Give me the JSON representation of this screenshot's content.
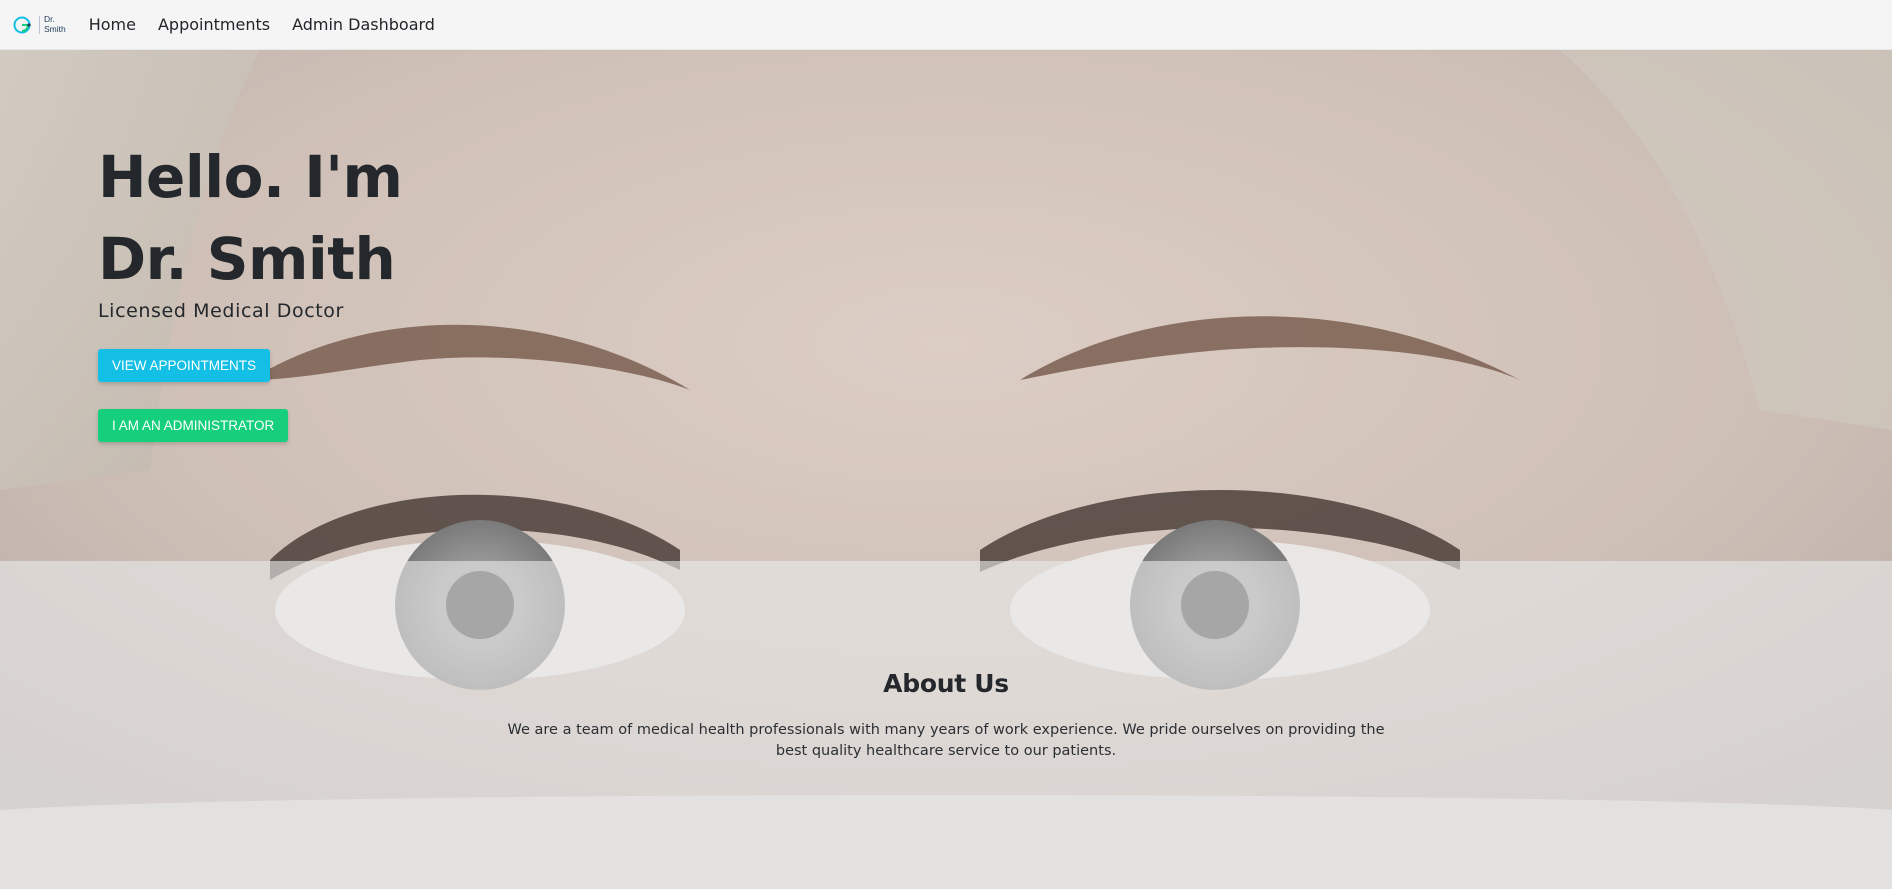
{
  "navbar": {
    "brand_line1": "Dr.",
    "brand_line2": "Smith",
    "links": [
      "Home",
      "Appointments",
      "Admin Dashboard"
    ]
  },
  "hero": {
    "title_line1": "Hello. I'm",
    "title_line2": "Dr. Smith",
    "subtitle": "Licensed Medical Doctor",
    "btn_appointments": "View Appointments",
    "btn_admin": "I am an Administrator"
  },
  "about": {
    "title": "About Us",
    "text": "We are a team of medical health professionals with many years of work experience. We pride ourselves on providing the best quality healthcare service to our patients."
  },
  "colors": {
    "brand_accent": "#14bfe6",
    "btn_appointments": "#14bfe6",
    "btn_admin": "#16cf7c",
    "text_dark": "#24282c",
    "navbar_bg": "#f5f5f5"
  },
  "icons": {
    "brand": "dr-smith-logo-icon"
  }
}
